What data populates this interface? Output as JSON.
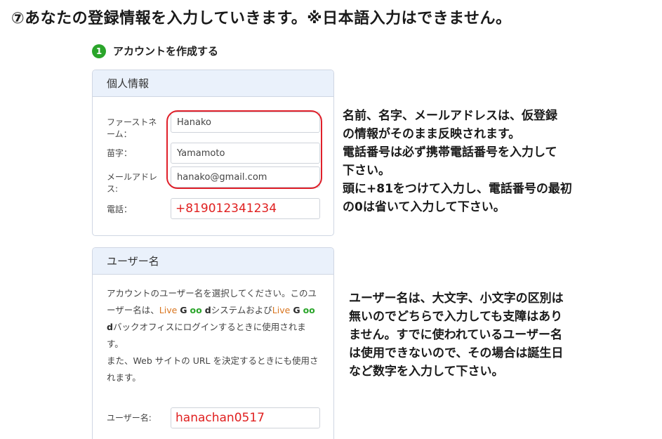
{
  "heading": "⑦あなたの登録情報を入力していきます。※日本語入力はできません。",
  "step": {
    "number": "1",
    "title": "アカウントを作成する"
  },
  "personal": {
    "header": "個人情報",
    "first_name_label_line1": "ファーストネ",
    "first_name_label_line2": "ーム：",
    "first_name_value": "Hanako",
    "last_name_label": "苗字：",
    "last_name_value": "Yamamoto",
    "email_label_line1": "メールアドレ",
    "email_label_line2": "ス:",
    "email_value": "hanako@gmail.com",
    "phone_label": "電話：",
    "phone_value": "+819012341234"
  },
  "username": {
    "header": "ユーザー名",
    "desc_part1": "アカウントのユーザー名を選択してください。このユーザー名は、",
    "brand_live": "Live",
    "brand_g": "G",
    "brand_oo": "oo",
    "brand_d": "d",
    "desc_part2": "システムおよび",
    "desc_part3": "バックオフィスにログインするときに使用されます。",
    "desc_part4": "また、Web サイトの URL を決定するときにも使用されます。",
    "label": "ユーザー名:",
    "value": "hanachan0517"
  },
  "notes": {
    "personal_line1": "名前、名字、メールアドレスは、仮登録",
    "personal_line2": "の情報がそのまま反映されます。",
    "personal_line3": "電話番号は必ず携帯電話番号を入力して",
    "personal_line4": "下さい。",
    "personal_line5": "頭に+81をつけて入力し、電話番号の最初",
    "personal_line6": "の0は省いて入力して下さい。",
    "username_line1": "ユーザー名は、大文字、小文字の区別は",
    "username_line2": "無いのでどちらで入力しても支障はあり",
    "username_line3": "ません。すでに使われているユーザー名",
    "username_line4": "は使用できないので、その場合は誕生日",
    "username_line5": "など数字を入力して下さい。"
  },
  "colors": {
    "accent_green": "#2aa52a",
    "highlight_red": "#e0202a",
    "panel_header_bg": "#eaf1fb",
    "brand_orange": "#d9751f"
  }
}
